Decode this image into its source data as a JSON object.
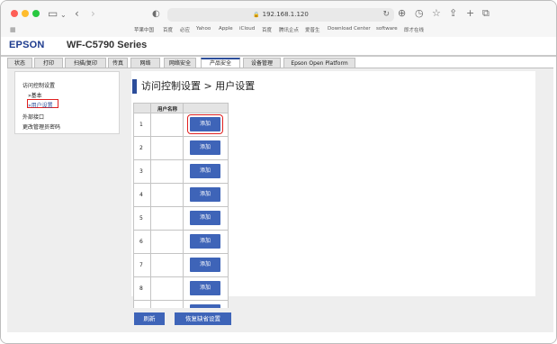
{
  "browser": {
    "url": "192.168.1.120",
    "favorites": [
      "苹果中国",
      "百度",
      "必应",
      "Yahoo",
      "Apple",
      "iCloud",
      "百度",
      "腾讯企点",
      "爱普生",
      "Download Center",
      "software",
      "即才在线"
    ]
  },
  "header": {
    "brand": "EPSON",
    "model": "WF-C5790 Series"
  },
  "tabs": [
    "状态",
    "打印",
    "扫描/复印",
    "传真",
    "网络",
    "网络安全",
    "产品安全",
    "设备管理",
    "Epson Open Platform"
  ],
  "active_tab": "产品安全",
  "sidebar": {
    "items": [
      {
        "label": "访问控制设置"
      },
      {
        "label": "»基本"
      },
      {
        "label": "»用户设置"
      },
      {
        "label": "外部接口"
      },
      {
        "label": "更改管理员密码"
      }
    ]
  },
  "main": {
    "title": "访问控制设置 > 用户设置",
    "table": {
      "header": "用户名称",
      "rows": [
        {
          "num": "1",
          "button": "添加"
        },
        {
          "num": "2",
          "button": "添加"
        },
        {
          "num": "3",
          "button": "添加"
        },
        {
          "num": "4",
          "button": "添加"
        },
        {
          "num": "5",
          "button": "添加"
        },
        {
          "num": "6",
          "button": "添加"
        },
        {
          "num": "7",
          "button": "添加"
        },
        {
          "num": "8",
          "button": "添加"
        },
        {
          "num": "",
          "button": ""
        }
      ]
    },
    "refresh_button": "刷新",
    "restore_button": "恢复缺省设置"
  },
  "colors": {
    "accent": "#3e64b8",
    "highlight": "#e02020",
    "brand": "#1d3b8e"
  }
}
